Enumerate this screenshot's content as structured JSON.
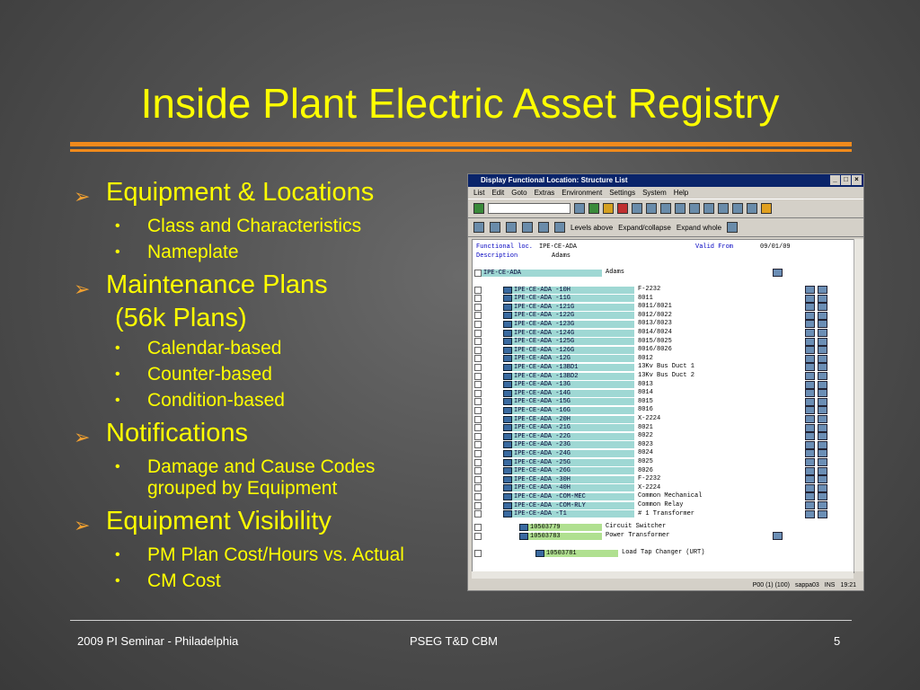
{
  "slide": {
    "title": "Inside Plant Electric Asset Registry",
    "bullets": [
      {
        "text": "Equipment & Locations",
        "subs": [
          "Class and Characteristics",
          "Nameplate"
        ]
      },
      {
        "text": "Maintenance Plans",
        "text2": "(56k Plans)",
        "subs": [
          "Calendar-based",
          "Counter-based",
          "Condition-based"
        ]
      },
      {
        "text": "Notifications",
        "subs": [
          "Damage and Cause Codes",
          "grouped by Equipment"
        ]
      },
      {
        "text": "Equipment Visibility",
        "subs": [
          "PM Plan Cost/Hours vs. Actual",
          "CM Cost"
        ]
      }
    ],
    "footer": {
      "left": "2009 PI Seminar  - Philadelphia",
      "center": "PSEG T&D CBM",
      "page": "5"
    }
  },
  "sap": {
    "window_title": "Display Functional Location: Structure List",
    "menu": [
      "List",
      "Edit",
      "Goto",
      "Extras",
      "Environment",
      "Settings",
      "System",
      "Help"
    ],
    "toolbar2": {
      "levels_above": "Levels above",
      "expand_collapse": "Expand/collapse",
      "expand_whole": "Expand whole"
    },
    "header": {
      "func_loc_label": "Functional loc.",
      "func_loc_value": "IPE-CE-ADA",
      "valid_from_label": "Valid From",
      "valid_from_value": "09/01/09",
      "desc_label": "Description",
      "desc_value": "Adams"
    },
    "root": {
      "id": "IPE-CE-ADA",
      "desc": "Adams"
    },
    "rows": [
      {
        "id": "IPE-CE-ADA -10H",
        "desc": "F-2232"
      },
      {
        "id": "IPE-CE-ADA -11G",
        "desc": "8011"
      },
      {
        "id": "IPE-CE-ADA -121G",
        "desc": "8011/8021"
      },
      {
        "id": "IPE-CE-ADA -122G",
        "desc": "8012/8022"
      },
      {
        "id": "IPE-CE-ADA -123G",
        "desc": "8013/8023"
      },
      {
        "id": "IPE-CE-ADA -124G",
        "desc": "8014/8024"
      },
      {
        "id": "IPE-CE-ADA -125G",
        "desc": "8015/8025"
      },
      {
        "id": "IPE-CE-ADA -126G",
        "desc": "8016/8026"
      },
      {
        "id": "IPE-CE-ADA -12G",
        "desc": "8012"
      },
      {
        "id": "IPE-CE-ADA -13BD1",
        "desc": "13Kv Bus Duct 1"
      },
      {
        "id": "IPE-CE-ADA -13BD2",
        "desc": "13Kv Bus Duct 2"
      },
      {
        "id": "IPE-CE-ADA -13G",
        "desc": "8013"
      },
      {
        "id": "IPE-CE-ADA -14G",
        "desc": "8014"
      },
      {
        "id": "IPE-CE-ADA -15G",
        "desc": "8015"
      },
      {
        "id": "IPE-CE-ADA -16G",
        "desc": "8016"
      },
      {
        "id": "IPE-CE-ADA -20H",
        "desc": "X-2224"
      },
      {
        "id": "IPE-CE-ADA -21G",
        "desc": "8021"
      },
      {
        "id": "IPE-CE-ADA -22G",
        "desc": "8022"
      },
      {
        "id": "IPE-CE-ADA -23G",
        "desc": "8023"
      },
      {
        "id": "IPE-CE-ADA -24G",
        "desc": "8024"
      },
      {
        "id": "IPE-CE-ADA -25G",
        "desc": "8025"
      },
      {
        "id": "IPE-CE-ADA -26G",
        "desc": "8026"
      },
      {
        "id": "IPE-CE-ADA -30H",
        "desc": "F-2232"
      },
      {
        "id": "IPE-CE-ADA -40H",
        "desc": "X-2224"
      },
      {
        "id": "IPE-CE-ADA -COM-MEC",
        "desc": "Common Mechanical"
      },
      {
        "id": "IPE-CE-ADA -COM-RLY",
        "desc": "Common Relay"
      },
      {
        "id": "IPE-CE-ADA -T1",
        "desc": "# 1 Transformer"
      }
    ],
    "equipment": [
      {
        "id": "10503779",
        "desc": "Circuit Switcher"
      },
      {
        "id": "10503783",
        "desc": "Power Transformer"
      },
      {
        "id": "10503781",
        "desc": "Load Tap Changer (URT)"
      }
    ],
    "status": [
      "P00 (1) (100)",
      "sappa03",
      "INS",
      "19:21"
    ]
  }
}
